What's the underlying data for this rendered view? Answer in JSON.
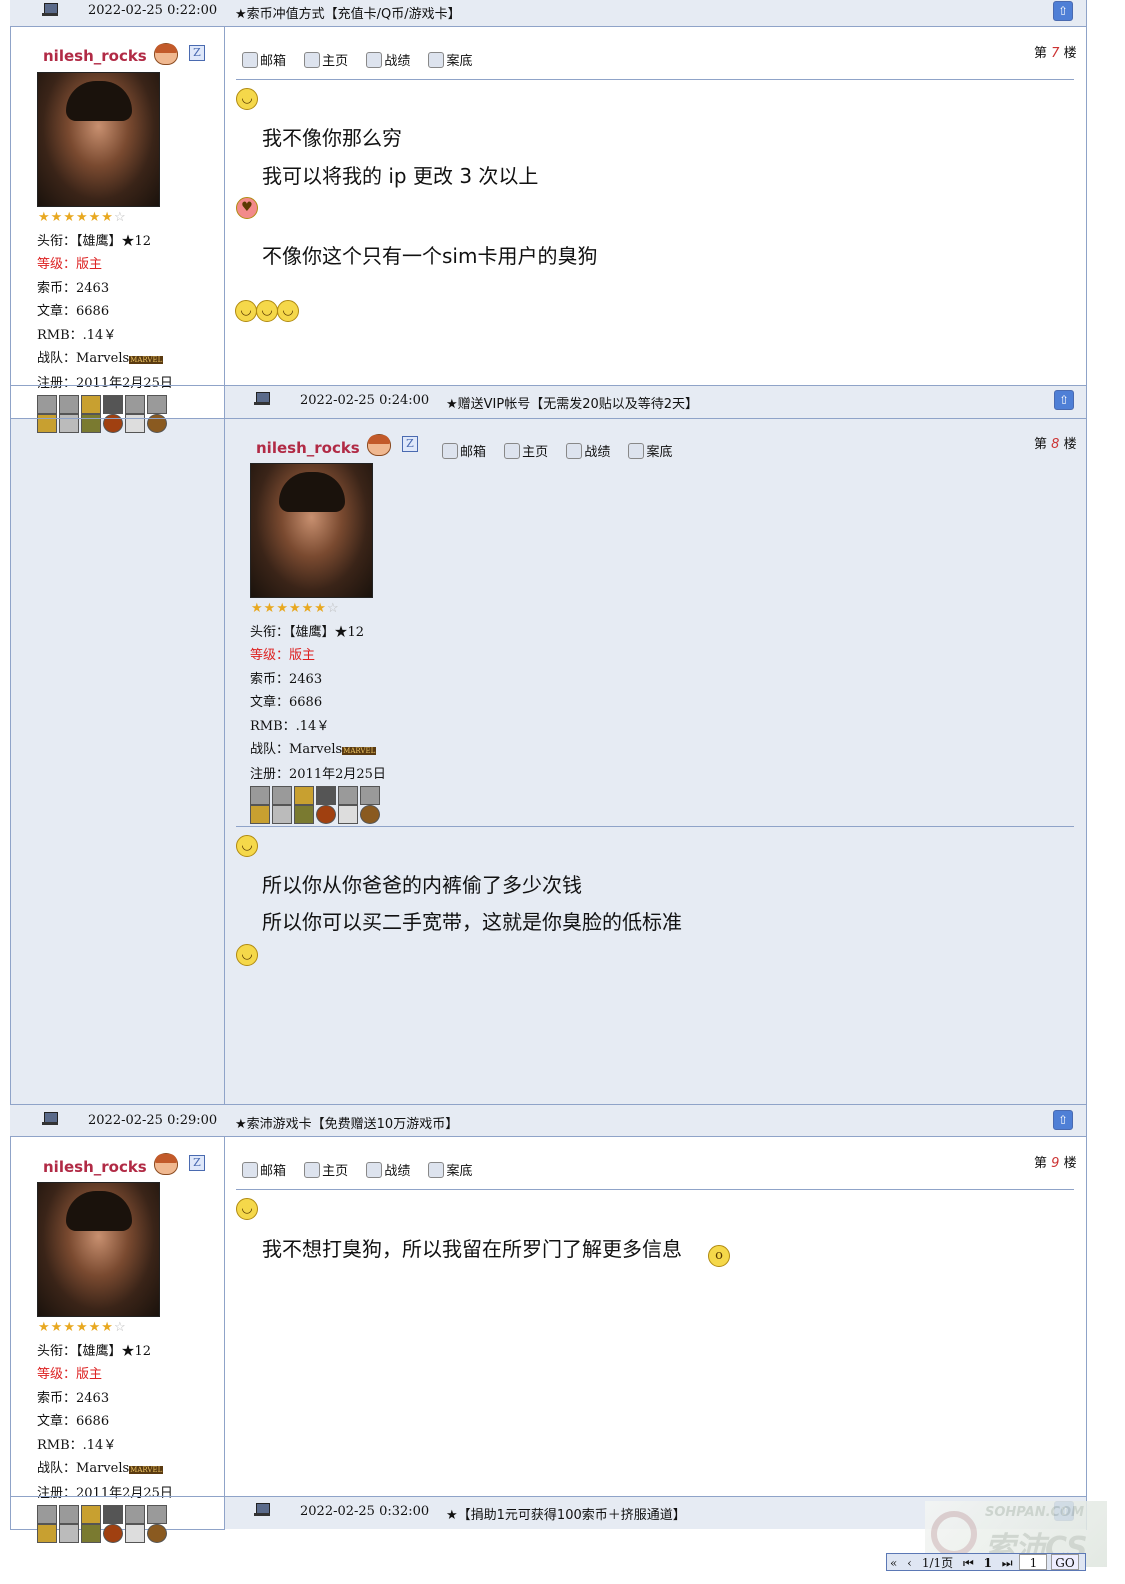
{
  "nav_links": {
    "mail": "邮箱",
    "home": "主页",
    "record": "战绩",
    "archive": "案底"
  },
  "post_bars": [
    {
      "time": "2022-02-25 0:22:00",
      "title": "★索币冲值方式【充值卡/Q币/游戏卡】"
    },
    {
      "time": "2022-02-25 0:24:00",
      "title": "★赠送VIP帐号【无需发20贴以及等待2天】"
    },
    {
      "time": "2022-02-25 0:29:00",
      "title": "★索沛游戏卡【免费赠送10万游戏币】"
    },
    {
      "time": "2022-02-25 0:32:00",
      "title": "★【捐助1元可获得100索币＋挤服通道】"
    }
  ],
  "user": {
    "name": "nilesh_rocks",
    "gender_badge": "Z",
    "rating_stars_filled": 6,
    "rating_stars_total": 7,
    "star_filled": "★",
    "star_empty": "☆",
    "title_label": "头衔：",
    "title_value": "【雄鹰】★12",
    "level_label": "等级：",
    "level_value": "版主",
    "coins_label": "索币：",
    "coins_value": "2463",
    "posts_label": "文章：",
    "posts_value": "6686",
    "rmb_label": "RMB：",
    "rmb_value": ".14￥",
    "team_label": "战队：",
    "team_value": "Marvels",
    "team_badge": "MARVEL",
    "reg_label": "注册：",
    "reg_value": "2011年2月25日"
  },
  "posts": [
    {
      "floor_prefix": "第",
      "floor_num": "7",
      "floor_suffix": "楼",
      "line1": "我不像你那么穷",
      "line2": "我可以将我的 ip 更改 3 次以上",
      "line3": "不像你这个只有一个sim卡用户的臭狗"
    },
    {
      "floor_prefix": "第",
      "floor_num": "8",
      "floor_suffix": "楼",
      "line1": "所以你从你爸爸的内裤偷了多少次钱",
      "line2": "所以你可以买二手宽带，这就是你臭脸的低标准"
    },
    {
      "floor_prefix": "第",
      "floor_num": "9",
      "floor_suffix": "楼",
      "line1": "我不想打臭狗，所以我留在所罗门了解更多信息"
    }
  ],
  "pager": {
    "pages": "1/1页",
    "current": "1",
    "page_input": "1",
    "go_label": "GO"
  },
  "watermark": {
    "domain": "SOHPAN.COM",
    "brand": "索沛CS"
  },
  "colors": {
    "border": "#8fa3c8",
    "bar_bg": "#e6ebf3",
    "username": "#b12a45",
    "level": "#dd2222",
    "floor_num": "#cc3333"
  }
}
